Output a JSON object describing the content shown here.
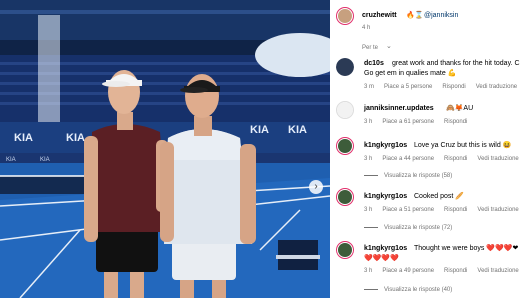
{
  "post": {
    "author": "cruzhewitt",
    "author_badges": "🔥⌛",
    "mention": "@janniksin",
    "time": "4 h",
    "translation_label": "Per te"
  },
  "comments": [
    {
      "user": "dc10s",
      "text_line1": "great work and thanks for the hit today. C",
      "text_line2": "Go get em in qualies mate 💪",
      "time": "3 m",
      "likes": "Piace a 5 persone",
      "reply": "Rispondi",
      "translate": "Vedi traduzione",
      "avatar_color": "#2b3a55"
    },
    {
      "user": "janniksinner.updates",
      "text_line1": "🙈🦊AU",
      "time": "3 h",
      "likes": "Piace a 61 persone",
      "reply": "Rispondi",
      "avatar_color": "#e9e9e9"
    },
    {
      "user": "k1ngkyrg1os",
      "text_line1": "Love ya Cruz but this is wild 😆",
      "time": "3 h",
      "likes": "Piace a 44 persone",
      "reply": "Rispondi",
      "translate": "Vedi traduzione",
      "replies": "Visualizza le risposte (58)",
      "avatar_color": "#3d5c3a"
    },
    {
      "user": "k1ngkyrg1os",
      "text_line1": "Cooked post 🥖",
      "time": "3 h",
      "likes": "Piace a 51 persone",
      "reply": "Rispondi",
      "translate": "Vedi traduzione",
      "replies": "Visualizza le risposte (72)",
      "avatar_color": "#3d5c3a"
    },
    {
      "user": "k1ngkyrg1os",
      "text_line1": "Thought we were boys ❤️❤️❤️❤",
      "text_line2": "❤️❤️❤️❤️",
      "time": "3 h",
      "likes": "Piace a 49 persone",
      "reply": "Rispondi",
      "translate": "Vedi traduzione",
      "replies": "Visualizza le risposte (40)",
      "avatar_color": "#3d5c3a"
    }
  ],
  "icons": {
    "next": "chevron-right-icon",
    "like": "heart-icon"
  },
  "colors": {
    "court": "#1f5fb0",
    "stands": "#16306a",
    "sky": "#0f2347",
    "accent": "#e1306c",
    "meta_text": "#737373"
  }
}
